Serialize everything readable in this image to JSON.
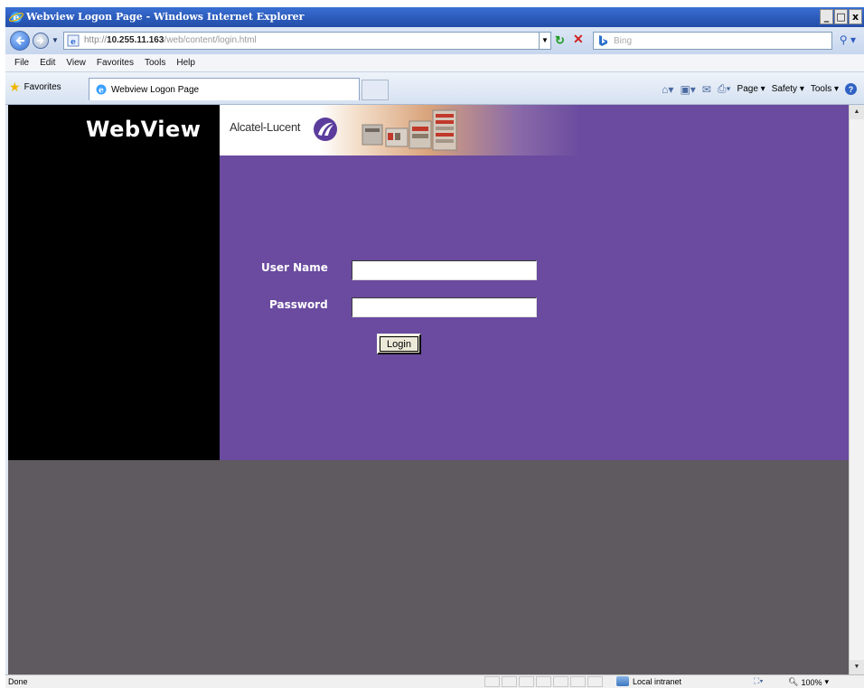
{
  "window": {
    "title": "Webview Logon Page - Windows Internet Explorer",
    "controls": {
      "minimize": "_",
      "maximize": "□",
      "close": "x"
    }
  },
  "address_bar": {
    "url_prefix": "http://",
    "url_host": "10.255.11.163",
    "url_path": "/web/content/login.html",
    "search_placeholder": "Bing"
  },
  "menu": [
    "File",
    "Edit",
    "View",
    "Favorites",
    "Tools",
    "Help"
  ],
  "favorites_bar": {
    "favorites_label": "Favorites",
    "tab_title": "Webview Logon Page",
    "commands": {
      "page": "Page ▾",
      "safety": "Safety ▾",
      "tools": "Tools ▾"
    }
  },
  "page": {
    "brand": "WebView",
    "vendor": "Alcatel-Lucent",
    "form": {
      "username_label": "User Name",
      "username_value": "",
      "password_label": "Password",
      "password_value": "",
      "login_button": "Login"
    },
    "colors": {
      "content_purple": "#6a4b9f",
      "left_black": "#000000",
      "background_gray": "#5e5a5f"
    }
  },
  "status_bar": {
    "status": "Done",
    "zone": "Local intranet",
    "zoom": "100%"
  },
  "icons": [
    "ie-icon",
    "back-icon",
    "forward-icon",
    "page-icon",
    "refresh-icon",
    "stop-icon",
    "bing-icon",
    "search-icon",
    "star-icon",
    "tab-icon",
    "home-icon",
    "feeds-icon",
    "mail-icon",
    "print-icon",
    "help-icon",
    "alcatel-lucent-logo",
    "zone-icon",
    "zoom-icon"
  ]
}
